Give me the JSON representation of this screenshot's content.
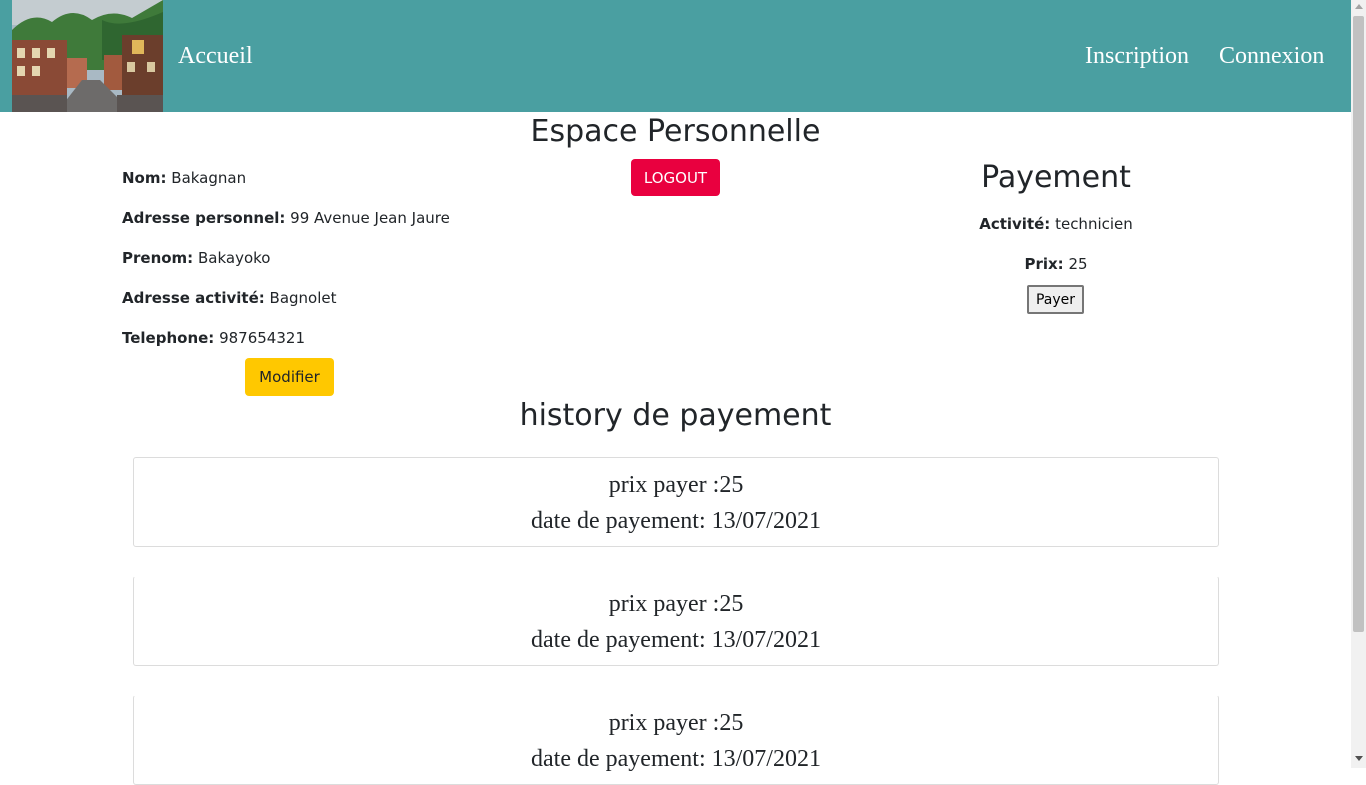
{
  "nav": {
    "home_label": "Accueil",
    "inscription_label": "Inscription",
    "connexion_label": "Connexion"
  },
  "page": {
    "title": "Espace Personnelle",
    "logout_label": "LOGOUT"
  },
  "profile": {
    "nom_label": "Nom:",
    "nom_value": "Bakagnan",
    "adresse_personnel_label": "Adresse personnel:",
    "adresse_personnel_value": "99 Avenue Jean Jaure",
    "prenom_label": "Prenom:",
    "prenom_value": "Bakayoko",
    "adresse_activite_label": "Adresse activité:",
    "adresse_activite_value": "Bagnolet",
    "telephone_label": "Telephone:",
    "telephone_value": "987654321",
    "modifier_label": "Modifier"
  },
  "payment": {
    "title": "Payement",
    "activite_label": "Activité:",
    "activite_value": "technicien",
    "prix_label": "Prix:",
    "prix_value": "25",
    "payer_label": "Payer"
  },
  "history": {
    "title": "history de payement",
    "entries": [
      {
        "prix": "prix payer :25",
        "date": "date de payement: 13/07/2021"
      },
      {
        "prix": "prix payer :25",
        "date": "date de payement: 13/07/2021"
      },
      {
        "prix": "prix payer :25",
        "date": "date de payement: 13/07/2021"
      }
    ]
  },
  "colors": {
    "navbar": "#4a9fa1",
    "logout": "#e9003f",
    "modifier": "#ffc800"
  }
}
